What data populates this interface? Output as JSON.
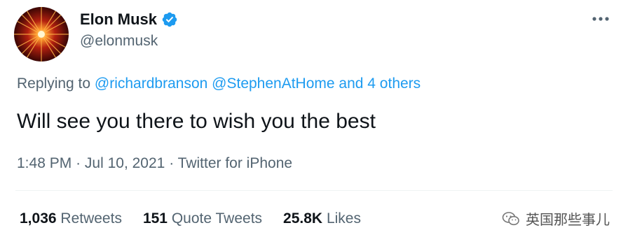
{
  "author": {
    "display_name": "Elon Musk",
    "handle": "@elonmusk",
    "avatar_icon": "avatar-starburst",
    "verified_icon": "verified-badge-icon"
  },
  "header": {
    "more_icon": "more-icon"
  },
  "reply": {
    "prefix": "Replying to",
    "mentions": [
      "@richardbranson",
      "@StephenAtHome"
    ],
    "others": "and 4 others"
  },
  "tweet": {
    "text": "Will see you there to wish you the best"
  },
  "meta": {
    "time": "1:48 PM",
    "separator": "·",
    "date": "Jul 10, 2021",
    "source": "Twitter for iPhone"
  },
  "stats": {
    "retweets_count": "1,036",
    "retweets_label": "Retweets",
    "quotes_count": "151",
    "quotes_label": "Quote Tweets",
    "likes_count": "25.8K",
    "likes_label": "Likes"
  },
  "watermark": {
    "text": "英国那些事儿",
    "icon": "wechat-icon"
  },
  "colors": {
    "accent": "#1d9bf0",
    "secondary_text": "#536471",
    "primary_text": "#0f1419"
  }
}
